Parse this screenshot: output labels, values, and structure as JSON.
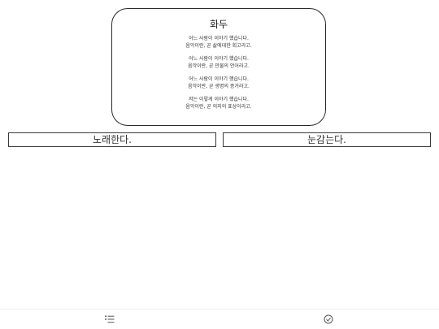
{
  "poem": {
    "title": "화두",
    "stanzas": [
      {
        "line1": "어느 사람이 이야기 했습니다.",
        "line2": "음악이란, 곧 삶에대한 회고라고."
      },
      {
        "line1": "어느 사람이 이야기 했습니다.",
        "line2": "음악이란, 곧 만물의 언어라고."
      },
      {
        "line1": "어느 사람이 이야기 했습니다.",
        "line2": "음악이란, 곧 생명의 증거라고."
      },
      {
        "line1": "저는 이렇게 이야기 했습니다.",
        "line2": "음악이란, 곧 의지의 표상이라고."
      }
    ]
  },
  "choices": {
    "left_label": "노래한다.",
    "right_label": "눈감는다."
  },
  "bottom_bar": {
    "left_icon": "list-icon",
    "right_icon": "check-circle-icon"
  }
}
